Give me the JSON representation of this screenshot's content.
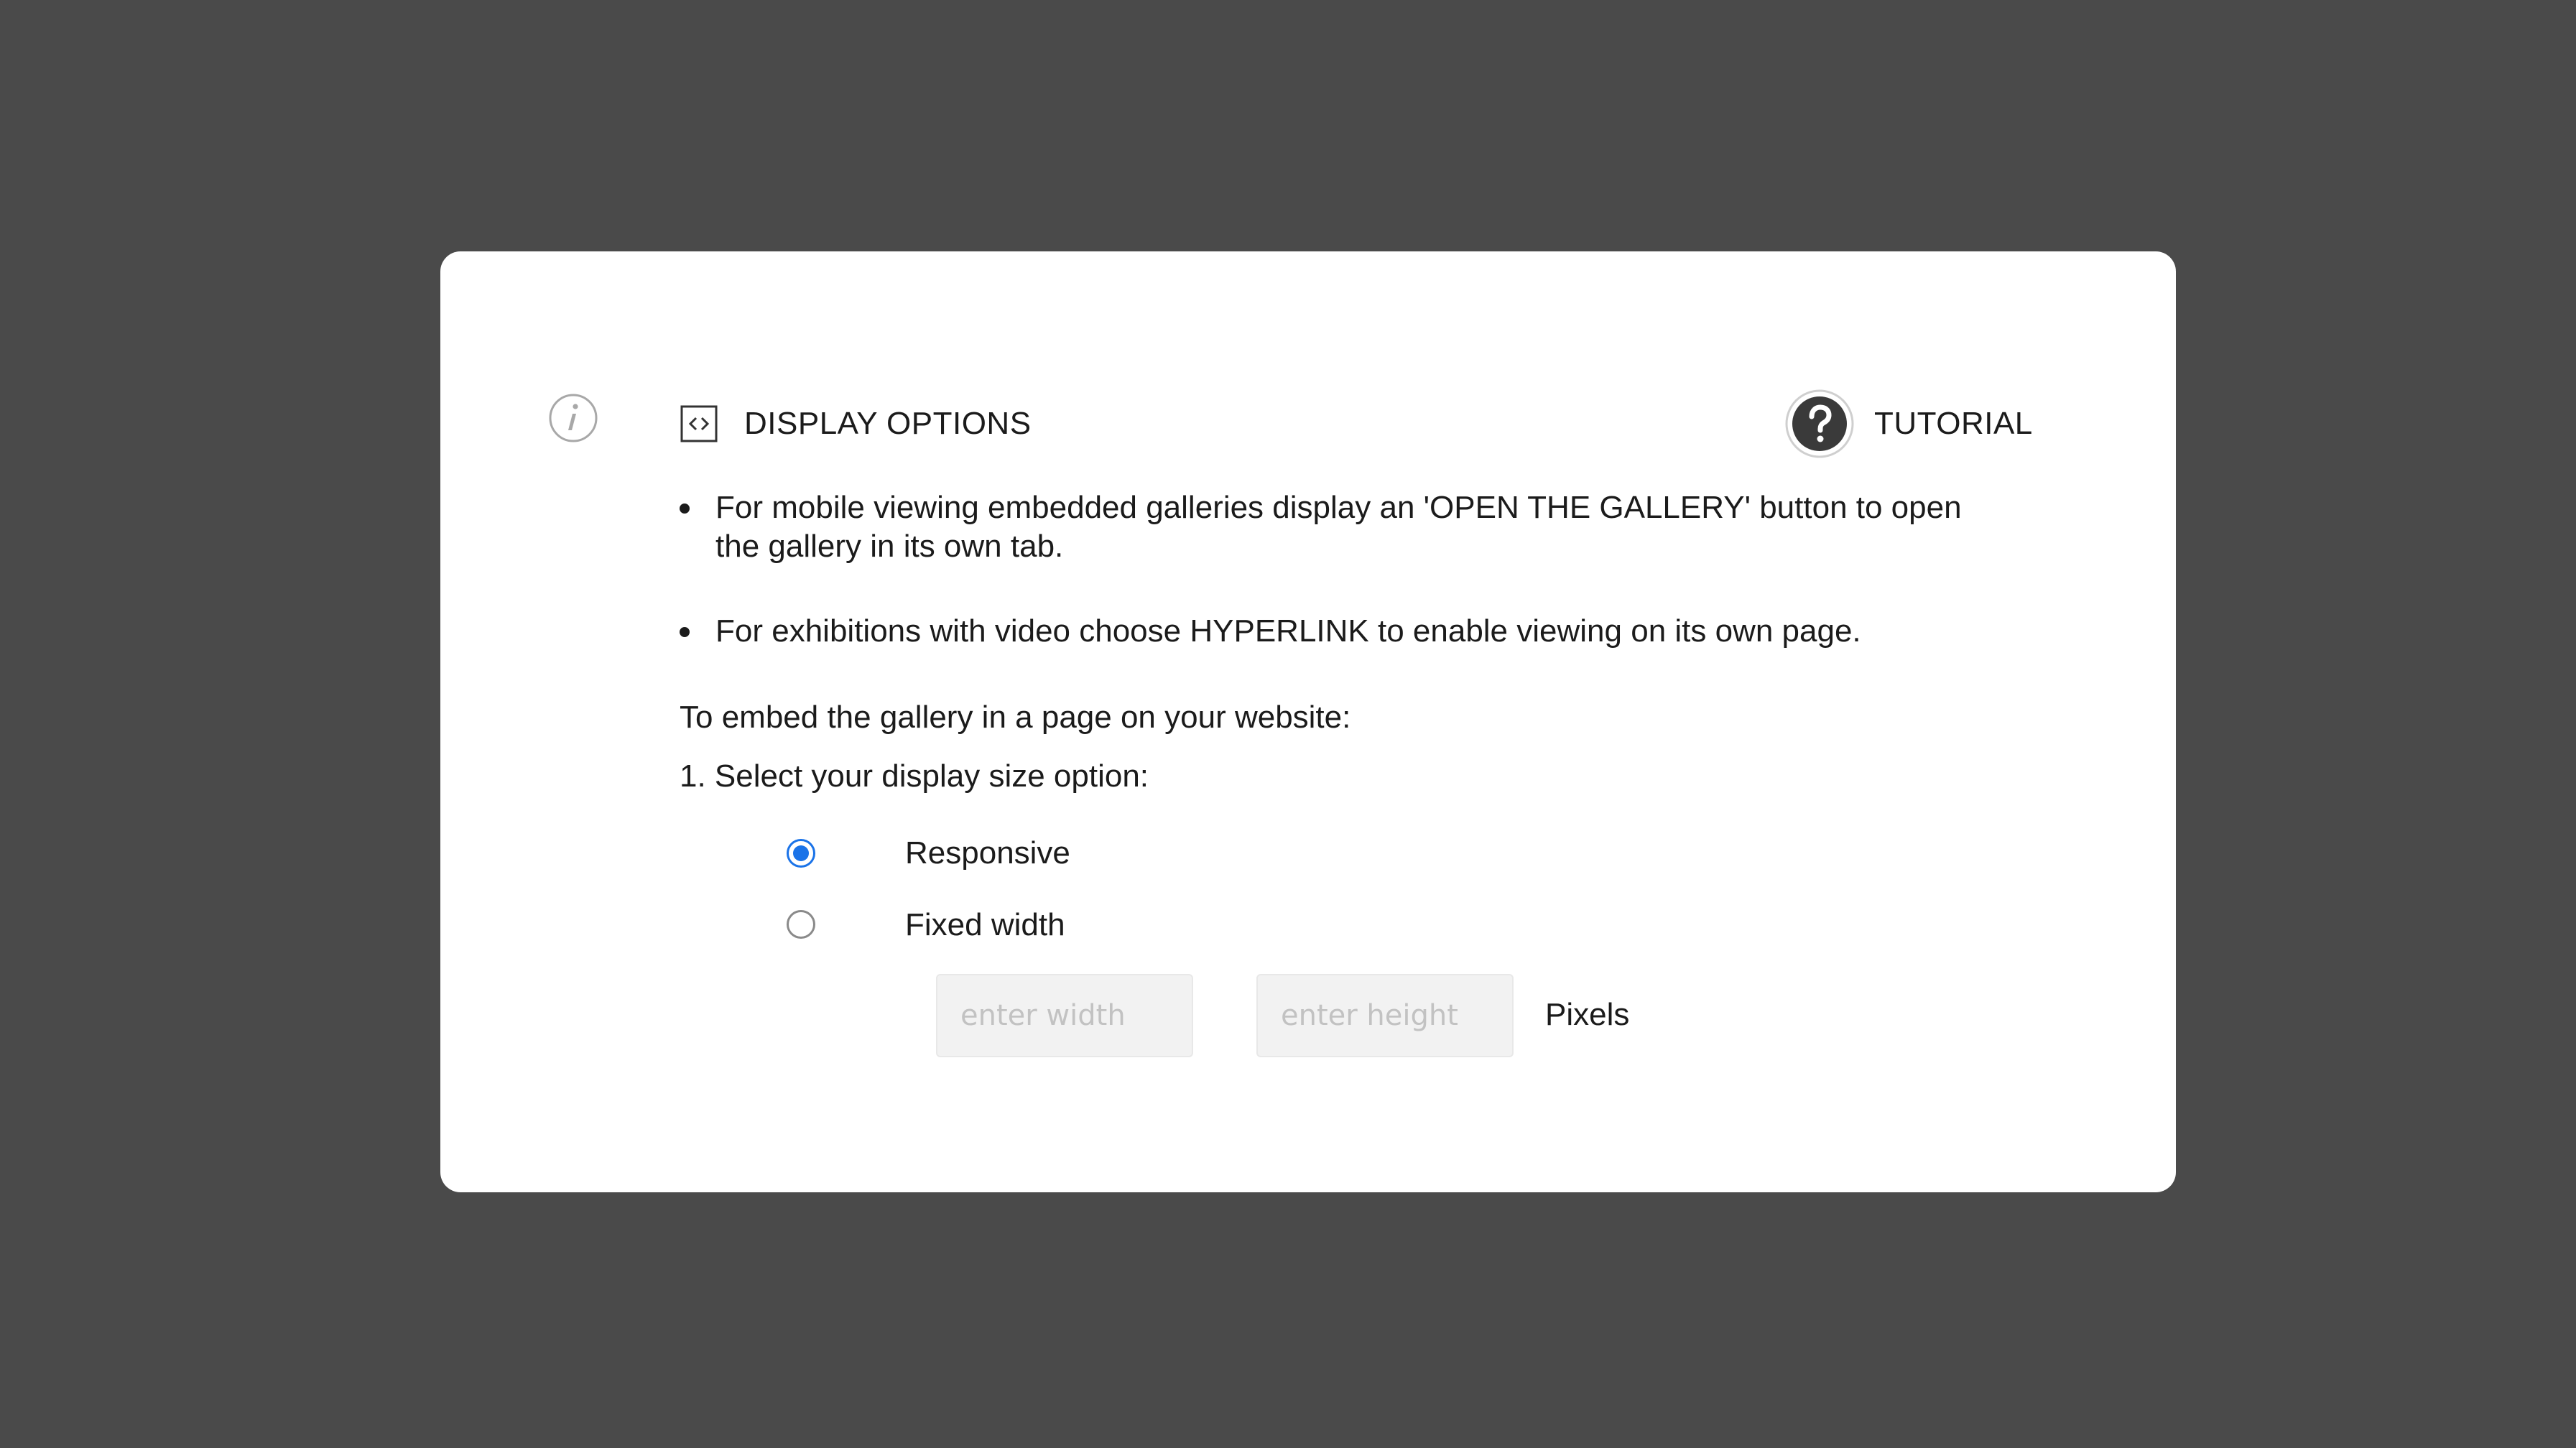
{
  "header": {
    "title": "DISPLAY OPTIONS",
    "tutorial_label": "TUTORIAL"
  },
  "icons": {
    "info": "info-icon",
    "code": "code-brackets-icon",
    "help": "question-mark-icon"
  },
  "notes": [
    "For mobile viewing embedded galleries display an 'OPEN THE GALLERY' button to open the gallery in its own tab.",
    "For exhibitions with video choose HYPERLINK to enable viewing on its own page."
  ],
  "intro_text": "To embed the gallery in a page on your website:",
  "step_1_label": "1. Select your display size option:",
  "size_options": [
    {
      "label": "Responsive",
      "selected": true
    },
    {
      "label": "Fixed width",
      "selected": false
    }
  ],
  "fixed_size": {
    "width_placeholder": "enter width",
    "height_placeholder": "enter height",
    "unit_label": "Pixels"
  },
  "colors": {
    "backdrop": "#4a4a4a",
    "radio_accent": "#1a73e8",
    "help_icon_fill": "#3a3a3a"
  }
}
